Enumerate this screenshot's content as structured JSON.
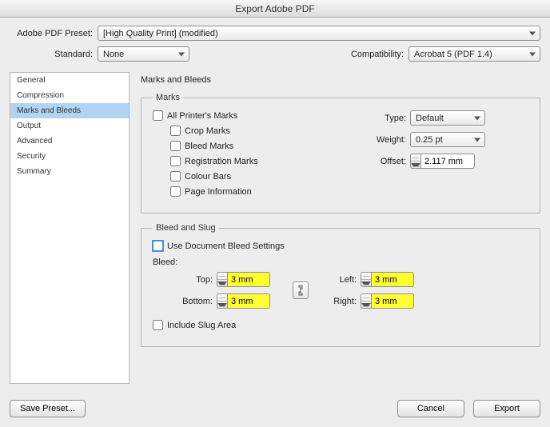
{
  "title": "Export Adobe PDF",
  "top": {
    "preset_label": "Adobe PDF Preset:",
    "preset_value": "[High Quality Print] (modified)",
    "standard_label": "Standard:",
    "standard_value": "None",
    "compat_label": "Compatibility:",
    "compat_value": "Acrobat 5 (PDF 1.4)"
  },
  "sidebar": {
    "items": [
      "General",
      "Compression",
      "Marks and Bleeds",
      "Output",
      "Advanced",
      "Security",
      "Summary"
    ],
    "selected_index": 2
  },
  "panel": {
    "title": "Marks and Bleeds",
    "marks": {
      "legend": "Marks",
      "all_printers": "All Printer's Marks",
      "crop": "Crop Marks",
      "bleed_marks": "Bleed Marks",
      "registration": "Registration Marks",
      "colour_bars": "Colour Bars",
      "page_info": "Page Information",
      "type_label": "Type:",
      "type_value": "Default",
      "weight_label": "Weight:",
      "weight_value": "0.25 pt",
      "offset_label": "Offset:",
      "offset_value": "2.117 mm"
    },
    "bleed": {
      "legend": "Bleed and Slug",
      "use_doc": "Use Document Bleed Settings",
      "bleed_label": "Bleed:",
      "top_label": "Top:",
      "top_value": "3 mm",
      "bottom_label": "Bottom:",
      "bottom_value": "3 mm",
      "left_label": "Left:",
      "left_value": "3 mm",
      "right_label": "Right:",
      "right_value": "3 mm",
      "include_slug": "Include Slug Area"
    }
  },
  "buttons": {
    "save_preset": "Save Preset...",
    "cancel": "Cancel",
    "export": "Export"
  }
}
